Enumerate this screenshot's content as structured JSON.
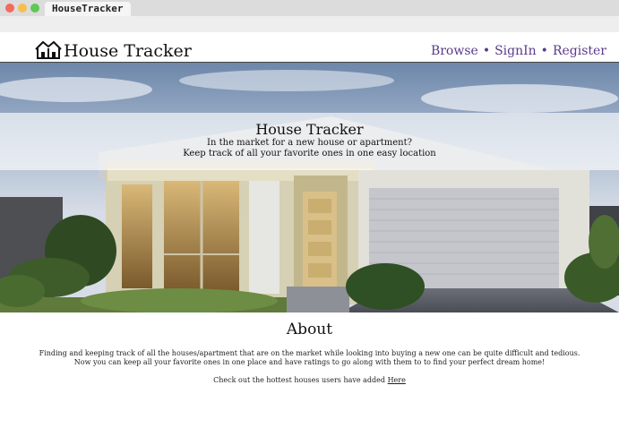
{
  "browser": {
    "tab_title": "HouseTracker"
  },
  "nav": {
    "brand": "House Tracker",
    "links": [
      "Browse",
      "SignIn",
      "Register"
    ],
    "separator": "•",
    "link_color": "#5a3a8a"
  },
  "hero": {
    "title": "House Tracker",
    "line1": "In the market for a new house or apartment?",
    "line2": "Keep track of all your favorite ones in one easy location"
  },
  "about": {
    "title": "About",
    "para1": "Finding and keeping track of all the houses/apartment that are on the market while looking into buying a new one can be quite difficult and tedious.",
    "para2": "Now you can keep all your favorite ones in one place and have ratings to go along with them to to find your perfect dream home!",
    "hot_prefix": "Check out the hottest houses users have added",
    "hot_link": "Here"
  },
  "icons": {
    "logo": "house-icon"
  }
}
